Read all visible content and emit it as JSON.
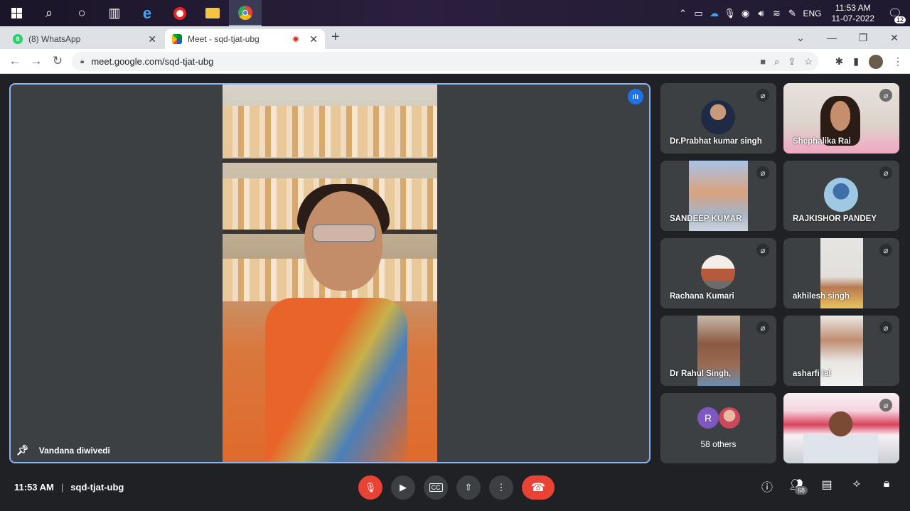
{
  "taskbar": {
    "icons": [
      "windows-start-icon",
      "search-icon",
      "cortana-icon",
      "task-view-icon",
      "edge-icon",
      "record-icon",
      "file-explorer-icon",
      "chrome-icon"
    ],
    "lang": "ENG",
    "time": "11:53 AM",
    "date": "11-07-2022",
    "notifications": "12"
  },
  "browser": {
    "tabs": [
      {
        "title": "(8) WhatsApp",
        "favicon_text": "8"
      },
      {
        "title": "Meet - sqd-tjat-ubg"
      }
    ],
    "url": "meet.google.com/sqd-tjat-ubg"
  },
  "meet": {
    "main_speaker": "Vandana diwivedi",
    "participants": [
      {
        "name": "Dr.Prabhat kumar singh"
      },
      {
        "name": "Shephalika Rai"
      },
      {
        "name": "SANDEEP KUMAR"
      },
      {
        "name": "RAJKISHOR PANDEY"
      },
      {
        "name": "Rachana Kumari"
      },
      {
        "name": "akhilesh singh"
      },
      {
        "name": "Dr Rahul Singh,"
      },
      {
        "name": "asharfi lal"
      }
    ],
    "others_initial": "R",
    "others_label": "58 others",
    "time": "11:53 AM",
    "meeting_code": "sqd-tjat-ubg",
    "people_count": "68"
  },
  "colors": {
    "accent": "#8ab4f8",
    "end_call": "#ea4335",
    "tile_bg": "#3c4043",
    "stage_bg": "#202124"
  }
}
